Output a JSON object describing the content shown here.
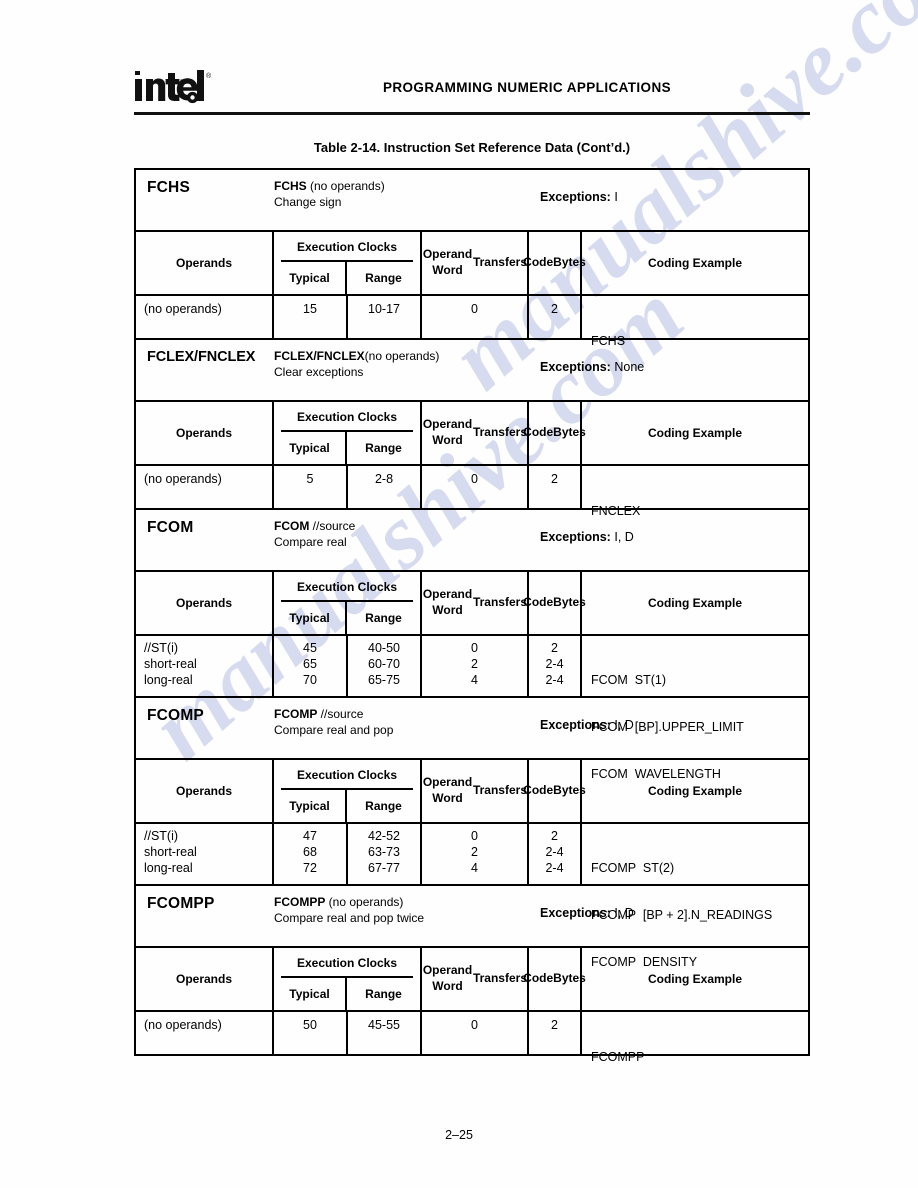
{
  "header": {
    "logo": "intel-logo",
    "title": "PROGRAMMING NUMERIC APPLICATIONS"
  },
  "table_caption": "Table 2-14.  Instruction Set Reference Data (Cont’d.)",
  "column_headers": {
    "operands": "Operands",
    "execution_clocks": "Execution Clocks",
    "typical": "Typical",
    "range": "Range",
    "operand_word_transfers_l1": "Operand Word",
    "operand_word_transfers_l2": "Transfers",
    "code_bytes_l1": "Code",
    "code_bytes_l2": "Bytes",
    "coding_example": "Coding Example"
  },
  "exceptions_label": "Exceptions:",
  "blocks": [
    {
      "mnemonic": "FCHS",
      "syntax_bold": "FCHS",
      "syntax_rest": " (no operands)",
      "description": "Change sign",
      "exceptions": "I",
      "rows": [
        {
          "operands": "(no operands)",
          "typical": "15",
          "range": "10-17",
          "transfers": "0",
          "code_bytes": "2",
          "coding_example": "FCHS"
        }
      ]
    },
    {
      "mnemonic": "FCLEX/FNCLEX",
      "syntax_bold": "FCLEX/FNCLEX",
      "syntax_rest": "(no operands)",
      "description": "Clear exceptions",
      "exceptions": "None",
      "rows": [
        {
          "operands": "(no operands)",
          "typical": "5",
          "range": "2-8",
          "transfers": "0",
          "code_bytes": "2",
          "coding_example": "FNCLEX"
        }
      ]
    },
    {
      "mnemonic": "FCOM",
      "syntax_bold": "FCOM",
      "syntax_rest": " //source",
      "description": "Compare real",
      "exceptions": "I, D",
      "rows": [
        {
          "operands": "//ST(i)",
          "typical": "45",
          "range": "40-50",
          "transfers": "0",
          "code_bytes": "2",
          "coding_example": "FCOM  ST(1)"
        },
        {
          "operands": "short-real",
          "typical": "65",
          "range": "60-70",
          "transfers": "2",
          "code_bytes": "2-4",
          "coding_example": "FCOM  [BP].UPPER_LIMIT"
        },
        {
          "operands": "long-real",
          "typical": "70",
          "range": "65-75",
          "transfers": "4",
          "code_bytes": "2-4",
          "coding_example": "FCOM  WAVELENGTH"
        }
      ]
    },
    {
      "mnemonic": "FCOMP",
      "syntax_bold": "FCOMP",
      "syntax_rest": " //source",
      "description": "Compare real and pop",
      "exceptions": "I, D",
      "rows": [
        {
          "operands": "//ST(i)",
          "typical": "47",
          "range": "42-52",
          "transfers": "0",
          "code_bytes": "2",
          "coding_example": "FCOMP  ST(2)"
        },
        {
          "operands": "short-real",
          "typical": "68",
          "range": "63-73",
          "transfers": "2",
          "code_bytes": "2-4",
          "coding_example": "FCOMP  [BP + 2].N_READINGS"
        },
        {
          "operands": "long-real",
          "typical": "72",
          "range": "67-77",
          "transfers": "4",
          "code_bytes": "2-4",
          "coding_example": "FCOMP  DENSITY"
        }
      ]
    },
    {
      "mnemonic": "FCOMPP",
      "syntax_bold": "FCOMPP",
      "syntax_rest": " (no operands)",
      "description": "Compare real and pop twice",
      "exceptions": "I, D",
      "rows": [
        {
          "operands": "(no operands)",
          "typical": "50",
          "range": "45-55",
          "transfers": "0",
          "code_bytes": "2",
          "coding_example": "FCOMPP"
        }
      ]
    }
  ],
  "footer": {
    "page_number": "2–25"
  },
  "watermark": {
    "line1": "manualshive.com",
    "line2": "manualshive.com",
    "color": "#b9bfe4"
  }
}
